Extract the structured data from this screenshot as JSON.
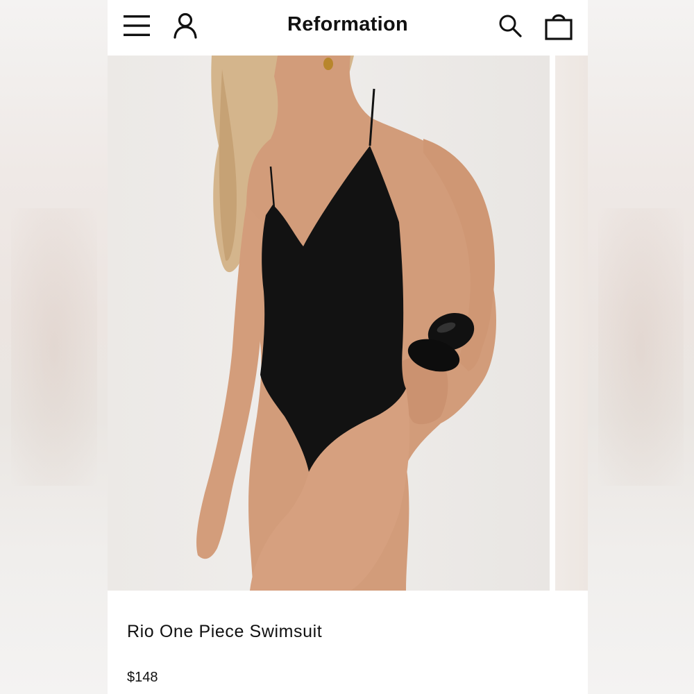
{
  "header": {
    "brand": "Reformation",
    "icons": [
      "menu-icon",
      "account-icon",
      "search-icon",
      "bag-icon"
    ]
  },
  "product": {
    "name": "Rio One Piece Swimsuit",
    "price": "$148",
    "image_alt": "Model wearing black one piece swimsuit"
  },
  "colors": {
    "text": "#111111",
    "background": "#ffffff",
    "swimsuit": "#121212"
  }
}
